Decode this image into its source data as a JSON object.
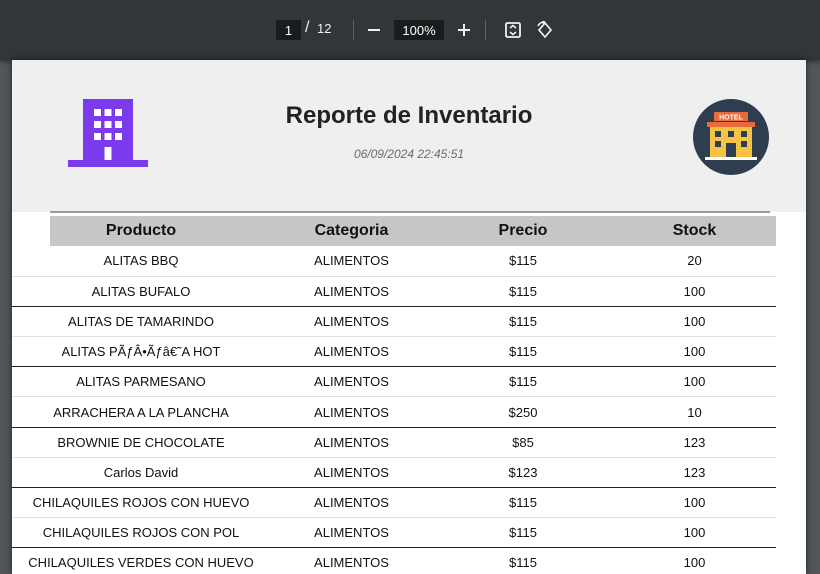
{
  "toolbar": {
    "current_page": "1",
    "separator": "/",
    "total_pages": "12",
    "zoom": "100%",
    "icons": {
      "zoom_out": "minus-icon",
      "zoom_in": "plus-icon",
      "fit": "fit-page-icon",
      "rotate": "rotate-icon"
    }
  },
  "report": {
    "title": "Reporte de Inventario",
    "datetime": "06/09/2024 22:45:51",
    "logo_left": "building-icon",
    "logo_right": "hotel-icon",
    "logo_right_text": "HOTEL",
    "colors": {
      "building": "#7c3aed",
      "hotel_circle": "#2e3e50",
      "header_bg": "#efefef",
      "table_header_bg": "#c6c6c6"
    }
  },
  "table": {
    "headers": [
      "Producto",
      "Categoria",
      "Precio",
      "Stock"
    ],
    "rows": [
      [
        "ALITAS BBQ",
        "ALIMENTOS",
        "$115",
        "20"
      ],
      [
        "ALITAS BUFALO",
        "ALIMENTOS",
        "$115",
        "100"
      ],
      [
        "ALITAS DE TAMARINDO",
        "ALIMENTOS",
        "$115",
        "100"
      ],
      [
        "ALITAS PÃƒÂ•Ãƒâ€˜A HOT",
        "ALIMENTOS",
        "$115",
        "100"
      ],
      [
        "ALITAS PARMESANO",
        "ALIMENTOS",
        "$115",
        "100"
      ],
      [
        "ARRACHERA A LA PLANCHA",
        "ALIMENTOS",
        "$250",
        "10"
      ],
      [
        "BROWNIE DE CHOCOLATE",
        "ALIMENTOS",
        "$85",
        "123"
      ],
      [
        "Carlos David",
        "ALIMENTOS",
        "$123",
        "123"
      ],
      [
        "CHILAQUILES ROJOS CON HUEVO",
        "ALIMENTOS",
        "$115",
        "100"
      ],
      [
        "CHILAQUILES ROJOS CON POL",
        "ALIMENTOS",
        "$115",
        "100"
      ],
      [
        "CHILAQUILES VERDES CON HUEVO",
        "ALIMENTOS",
        "$115",
        "100"
      ]
    ]
  }
}
